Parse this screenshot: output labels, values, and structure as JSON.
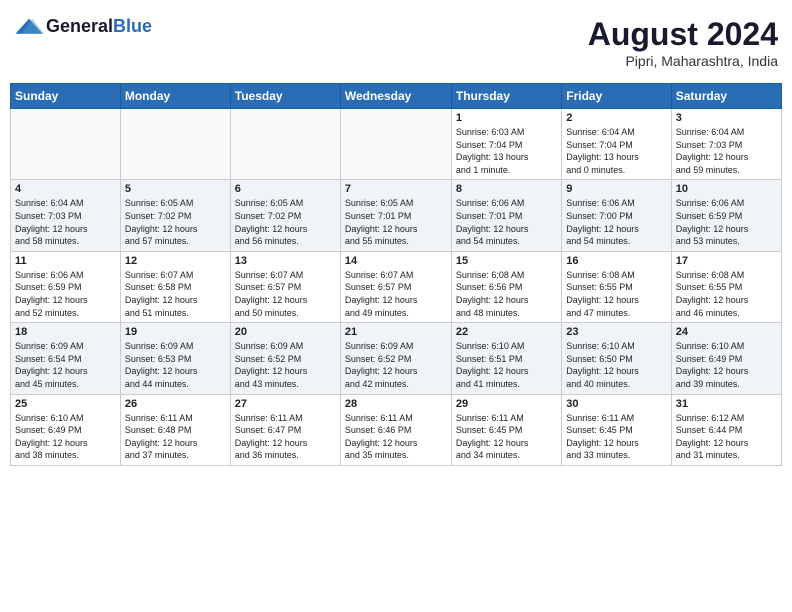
{
  "header": {
    "logo_general": "General",
    "logo_blue": "Blue",
    "month_title": "August 2024",
    "location": "Pipri, Maharashtra, India"
  },
  "days_of_week": [
    "Sunday",
    "Monday",
    "Tuesday",
    "Wednesday",
    "Thursday",
    "Friday",
    "Saturday"
  ],
  "weeks": [
    [
      {
        "day": "",
        "info": ""
      },
      {
        "day": "",
        "info": ""
      },
      {
        "day": "",
        "info": ""
      },
      {
        "day": "",
        "info": ""
      },
      {
        "day": "1",
        "info": "Sunrise: 6:03 AM\nSunset: 7:04 PM\nDaylight: 13 hours\nand 1 minute."
      },
      {
        "day": "2",
        "info": "Sunrise: 6:04 AM\nSunset: 7:04 PM\nDaylight: 13 hours\nand 0 minutes."
      },
      {
        "day": "3",
        "info": "Sunrise: 6:04 AM\nSunset: 7:03 PM\nDaylight: 12 hours\nand 59 minutes."
      }
    ],
    [
      {
        "day": "4",
        "info": "Sunrise: 6:04 AM\nSunset: 7:03 PM\nDaylight: 12 hours\nand 58 minutes."
      },
      {
        "day": "5",
        "info": "Sunrise: 6:05 AM\nSunset: 7:02 PM\nDaylight: 12 hours\nand 57 minutes."
      },
      {
        "day": "6",
        "info": "Sunrise: 6:05 AM\nSunset: 7:02 PM\nDaylight: 12 hours\nand 56 minutes."
      },
      {
        "day": "7",
        "info": "Sunrise: 6:05 AM\nSunset: 7:01 PM\nDaylight: 12 hours\nand 55 minutes."
      },
      {
        "day": "8",
        "info": "Sunrise: 6:06 AM\nSunset: 7:01 PM\nDaylight: 12 hours\nand 54 minutes."
      },
      {
        "day": "9",
        "info": "Sunrise: 6:06 AM\nSunset: 7:00 PM\nDaylight: 12 hours\nand 54 minutes."
      },
      {
        "day": "10",
        "info": "Sunrise: 6:06 AM\nSunset: 6:59 PM\nDaylight: 12 hours\nand 53 minutes."
      }
    ],
    [
      {
        "day": "11",
        "info": "Sunrise: 6:06 AM\nSunset: 6:59 PM\nDaylight: 12 hours\nand 52 minutes."
      },
      {
        "day": "12",
        "info": "Sunrise: 6:07 AM\nSunset: 6:58 PM\nDaylight: 12 hours\nand 51 minutes."
      },
      {
        "day": "13",
        "info": "Sunrise: 6:07 AM\nSunset: 6:57 PM\nDaylight: 12 hours\nand 50 minutes."
      },
      {
        "day": "14",
        "info": "Sunrise: 6:07 AM\nSunset: 6:57 PM\nDaylight: 12 hours\nand 49 minutes."
      },
      {
        "day": "15",
        "info": "Sunrise: 6:08 AM\nSunset: 6:56 PM\nDaylight: 12 hours\nand 48 minutes."
      },
      {
        "day": "16",
        "info": "Sunrise: 6:08 AM\nSunset: 6:55 PM\nDaylight: 12 hours\nand 47 minutes."
      },
      {
        "day": "17",
        "info": "Sunrise: 6:08 AM\nSunset: 6:55 PM\nDaylight: 12 hours\nand 46 minutes."
      }
    ],
    [
      {
        "day": "18",
        "info": "Sunrise: 6:09 AM\nSunset: 6:54 PM\nDaylight: 12 hours\nand 45 minutes."
      },
      {
        "day": "19",
        "info": "Sunrise: 6:09 AM\nSunset: 6:53 PM\nDaylight: 12 hours\nand 44 minutes."
      },
      {
        "day": "20",
        "info": "Sunrise: 6:09 AM\nSunset: 6:52 PM\nDaylight: 12 hours\nand 43 minutes."
      },
      {
        "day": "21",
        "info": "Sunrise: 6:09 AM\nSunset: 6:52 PM\nDaylight: 12 hours\nand 42 minutes."
      },
      {
        "day": "22",
        "info": "Sunrise: 6:10 AM\nSunset: 6:51 PM\nDaylight: 12 hours\nand 41 minutes."
      },
      {
        "day": "23",
        "info": "Sunrise: 6:10 AM\nSunset: 6:50 PM\nDaylight: 12 hours\nand 40 minutes."
      },
      {
        "day": "24",
        "info": "Sunrise: 6:10 AM\nSunset: 6:49 PM\nDaylight: 12 hours\nand 39 minutes."
      }
    ],
    [
      {
        "day": "25",
        "info": "Sunrise: 6:10 AM\nSunset: 6:49 PM\nDaylight: 12 hours\nand 38 minutes."
      },
      {
        "day": "26",
        "info": "Sunrise: 6:11 AM\nSunset: 6:48 PM\nDaylight: 12 hours\nand 37 minutes."
      },
      {
        "day": "27",
        "info": "Sunrise: 6:11 AM\nSunset: 6:47 PM\nDaylight: 12 hours\nand 36 minutes."
      },
      {
        "day": "28",
        "info": "Sunrise: 6:11 AM\nSunset: 6:46 PM\nDaylight: 12 hours\nand 35 minutes."
      },
      {
        "day": "29",
        "info": "Sunrise: 6:11 AM\nSunset: 6:45 PM\nDaylight: 12 hours\nand 34 minutes."
      },
      {
        "day": "30",
        "info": "Sunrise: 6:11 AM\nSunset: 6:45 PM\nDaylight: 12 hours\nand 33 minutes."
      },
      {
        "day": "31",
        "info": "Sunrise: 6:12 AM\nSunset: 6:44 PM\nDaylight: 12 hours\nand 31 minutes."
      }
    ]
  ]
}
